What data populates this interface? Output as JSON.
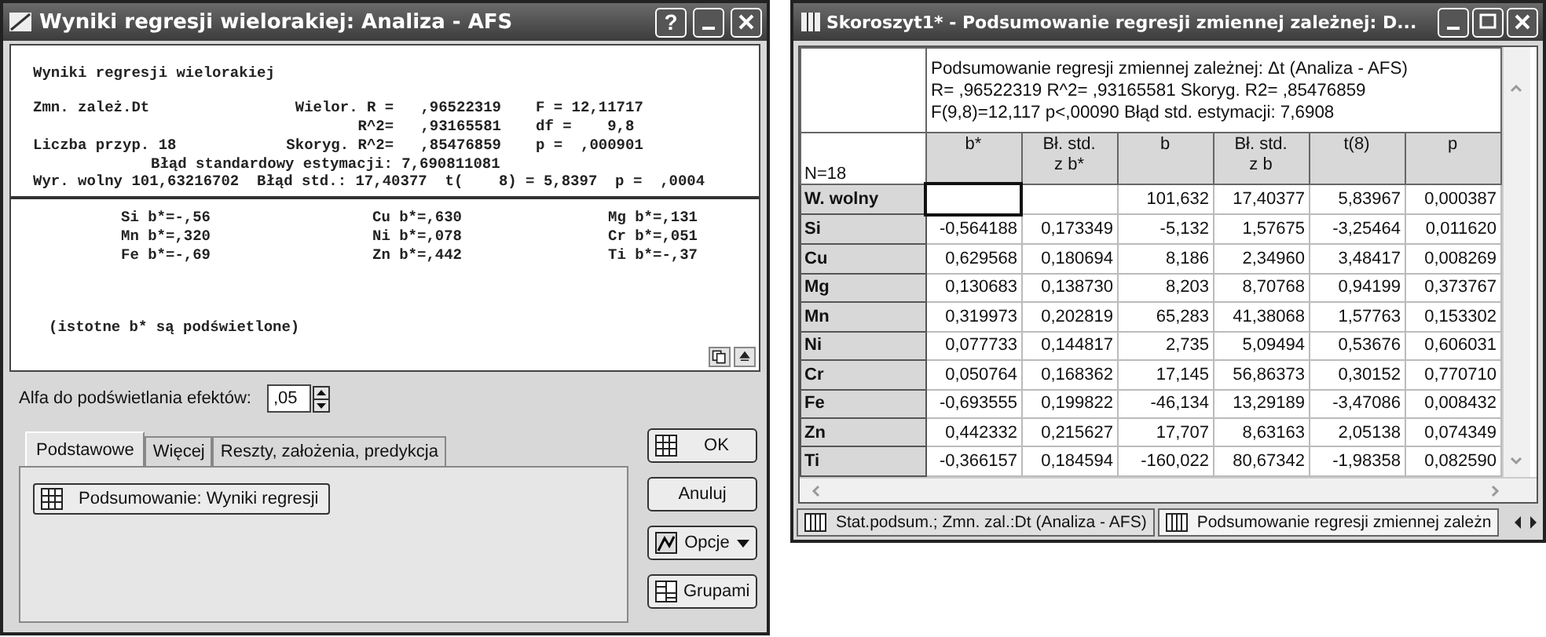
{
  "left_window": {
    "title": "Wyniki regresji wielorakiej: Analiza - AFS",
    "help_label": "?",
    "report": {
      "heading": "Wyniki regresji wielorakiej",
      "summary": [
        {
          "left": "Zmn. zależ.Dt",
          "middle": "Wielor. R =   ,96522319",
          "right": "F = 12,11717"
        },
        {
          "middle": "R^2=   ,93165581",
          "right": "df =    9,8"
        },
        {
          "left": "Liczba przyp. 18",
          "middle": "Skoryg. R^2=   ,85476859",
          "right": "p =  ,000901"
        }
      ],
      "std_error_line": "Błąd standardowy estymacji: 7,690811081",
      "intercept_line": "Wyr. wolny 101,63216702  Błąd std.: 17,40377  t(    8) = 5,8397  p =  ,0004",
      "coefficients": [
        "Si b*=-,56",
        "Cu b*=,630",
        "Mg b*=,131",
        "Mn b*=,320",
        "Ni b*=,078",
        "Cr b*=,051",
        "Fe b*=-,69",
        "Zn b*=,442",
        "Ti b*=-,37"
      ],
      "note": "(istotne b* są podświetlone)"
    },
    "alpha": {
      "label": "Alfa do podświetlania efektów:",
      "value": ",05"
    },
    "tabs": [
      {
        "label": "Podstawowe",
        "selected": true
      },
      {
        "label": "Więcej",
        "selected": false
      },
      {
        "label": "Reszty, założenia, predykcja",
        "selected": false
      }
    ],
    "panel_button": "Podsumowanie:  Wyniki regresji",
    "buttons": [
      {
        "kind": "ok",
        "label": "OK"
      },
      {
        "kind": "cancel",
        "label": "Anuluj"
      },
      {
        "kind": "options",
        "label": "Opcje"
      },
      {
        "kind": "groups",
        "label": "Grupami"
      }
    ]
  },
  "right_window": {
    "title": "Skoroszyt1* - Podsumowanie regresji zmiennej zależnej: D...",
    "info_lines": [
      "Podsumowanie regresji zmiennej zależnej:   Δt (Analiza - AFS)",
      "R= ,96522319 R^2= ,93165581 Skoryg. R2= ,85476859",
      "F(9,8)=12,117 p<,00090 Błąd std. estymacji: 7,6908"
    ],
    "row_header_label": "N=18",
    "columns": [
      {
        "label": "b*"
      },
      {
        "label": "Bł. std.",
        "sublabel": "z b*"
      },
      {
        "label": "b"
      },
      {
        "label": "Bł. std.",
        "sublabel": "z b"
      },
      {
        "label": "t(8)"
      },
      {
        "label": "p"
      }
    ],
    "rows": [
      {
        "label": "W. wolny",
        "cells": [
          null,
          null,
          "101,632",
          "17,40377",
          "5,83967",
          "0,000387"
        ]
      },
      {
        "label": "Si",
        "cells": [
          "-0,564188",
          "0,173349",
          "-5,132",
          "1,57675",
          "-3,25464",
          "0,011620"
        ]
      },
      {
        "label": "Cu",
        "cells": [
          "0,629568",
          "0,180694",
          "8,186",
          "2,34960",
          "3,48417",
          "0,008269"
        ]
      },
      {
        "label": "Mg",
        "cells": [
          "0,130683",
          "0,138730",
          "8,203",
          "8,70768",
          "0,94199",
          "0,373767"
        ]
      },
      {
        "label": "Mn",
        "cells": [
          "0,319973",
          "0,202819",
          "65,283",
          "41,38068",
          "1,57763",
          "0,153302"
        ]
      },
      {
        "label": "Ni",
        "cells": [
          "0,077733",
          "0,144817",
          "2,735",
          "5,09494",
          "0,53676",
          "0,606031"
        ]
      },
      {
        "label": "Cr",
        "cells": [
          "0,050764",
          "0,168362",
          "17,145",
          "56,86373",
          "0,30152",
          "0,770710"
        ]
      },
      {
        "label": "Fe",
        "cells": [
          "-0,693555",
          "0,199822",
          "-46,134",
          "13,29189",
          "-3,47086",
          "0,008432"
        ]
      },
      {
        "label": "Zn",
        "cells": [
          "0,442332",
          "0,215627",
          "17,707",
          "8,63163",
          "2,05138",
          "0,074349"
        ]
      },
      {
        "label": "Ti",
        "cells": [
          "-0,366157",
          "0,184594",
          "-160,022",
          "80,67342",
          "-1,98358",
          "0,082590"
        ]
      }
    ],
    "sheet_tabs": [
      {
        "label": "Stat.podsum.; Zmn. zal.:Dt (Analiza - AFS)",
        "selected": false
      },
      {
        "label": "Podsumowanie regresji zmiennej zależn",
        "selected": true
      }
    ]
  }
}
